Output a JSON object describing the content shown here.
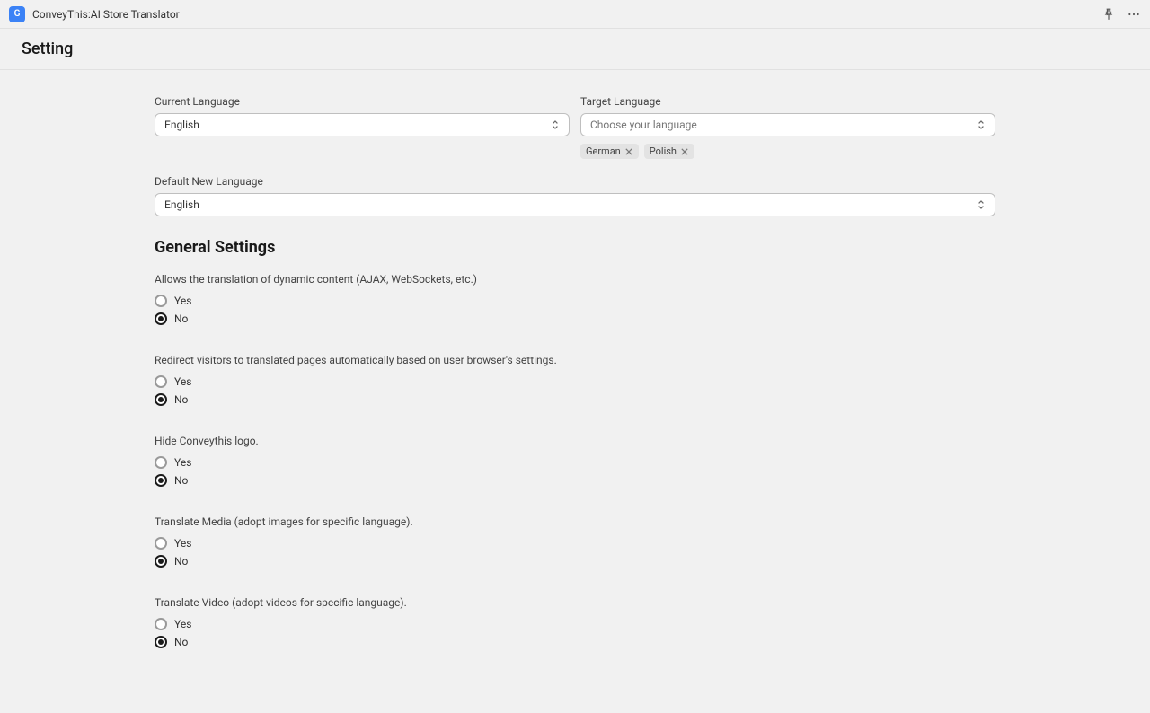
{
  "topbar": {
    "app_name": "ConveyThis:AI Store Translator",
    "app_icon_letter": "G"
  },
  "page": {
    "title": "Setting"
  },
  "language": {
    "current_label": "Current Language",
    "current_value": "English",
    "target_label": "Target Language",
    "target_placeholder": "Choose your language",
    "target_tags": [
      "German",
      "Polish"
    ],
    "default_new_label": "Default New Language",
    "default_new_value": "English"
  },
  "general": {
    "title": "General Settings",
    "yes": "Yes",
    "no": "No",
    "settings": [
      {
        "label": "Allows the translation of dynamic content (AJAX, WebSockets, etc.)",
        "value": "No"
      },
      {
        "label": "Redirect visitors to translated pages automatically based on user browser's settings.",
        "value": "No"
      },
      {
        "label": "Hide Conveythis logo.",
        "value": "No"
      },
      {
        "label": "Translate Media (adopt images for specific language).",
        "value": "No"
      },
      {
        "label": "Translate Video (adopt videos for specific language).",
        "value": "No"
      }
    ]
  }
}
